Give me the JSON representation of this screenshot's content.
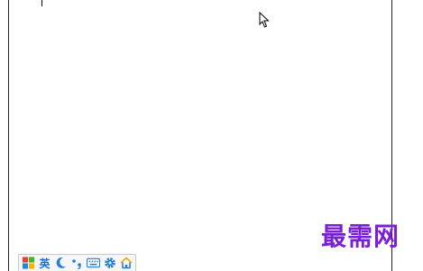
{
  "ime_toolbar": {
    "language_label": "英",
    "icons": [
      "windows-logo-icon",
      "crescent-moon-icon",
      "punctuation-icon",
      "keyboard-icon",
      "gear-icon",
      "home-icon"
    ]
  },
  "watermark": {
    "text": "最需网"
  },
  "colors": {
    "watermark": "#7a1fd6",
    "ime_accent": "#1e7fd8"
  }
}
